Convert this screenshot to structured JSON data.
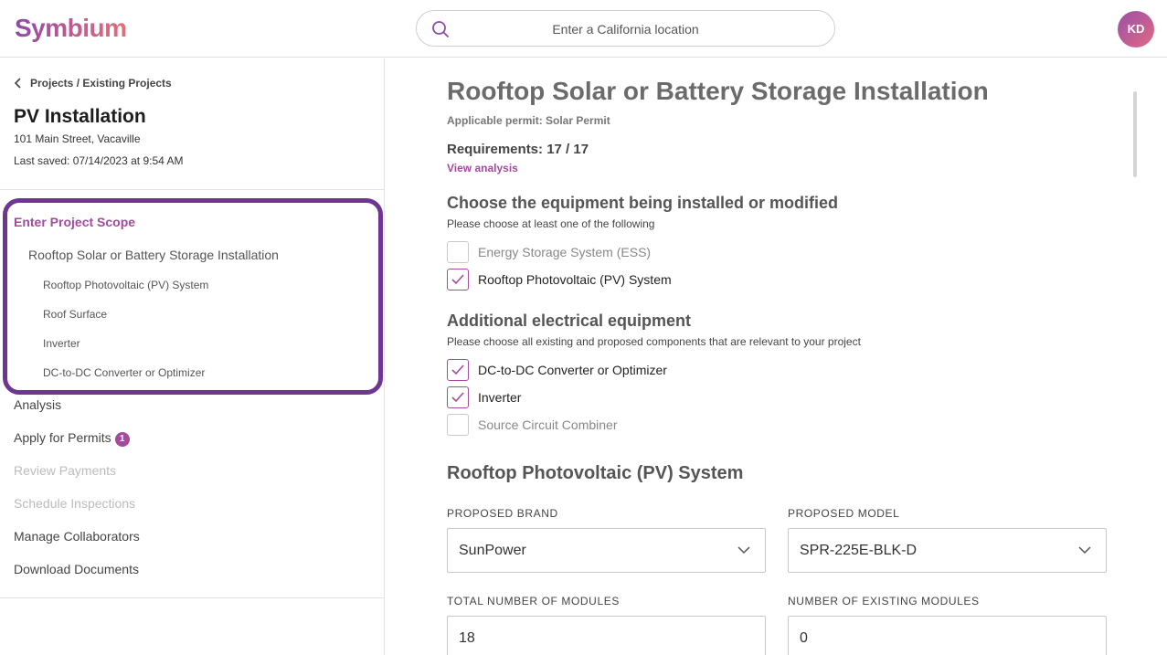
{
  "header": {
    "logo": "Symbium",
    "search_placeholder": "Enter a California location",
    "avatar_initials": "KD"
  },
  "sidebar": {
    "breadcrumb": "Projects / Existing Projects",
    "project_title": "PV Installation",
    "project_address": "101 Main Street, Vacaville",
    "last_saved": "Last saved: 07/14/2023 at 9:54 AM",
    "scope": {
      "title": "Enter Project Scope",
      "level1": "Rooftop Solar or Battery Storage Installation",
      "level2": [
        "Rooftop Photovoltaic (PV) System",
        "Roof Surface",
        "Inverter",
        "DC-to-DC Converter or Optimizer"
      ]
    },
    "nav": [
      {
        "label": "Analysis",
        "enabled": true
      },
      {
        "label": "Apply for Permits",
        "enabled": true,
        "badge": "1"
      },
      {
        "label": "Review Payments",
        "enabled": false
      },
      {
        "label": "Schedule Inspections",
        "enabled": false
      },
      {
        "label": "Manage Collaborators",
        "enabled": true
      },
      {
        "label": "Download Documents",
        "enabled": true
      }
    ]
  },
  "main": {
    "title": "Rooftop Solar or Battery Storage Installation",
    "permit": "Applicable permit: Solar Permit",
    "requirements": "Requirements: 17 / 17",
    "view_analysis": "View analysis",
    "equipment": {
      "heading": "Choose the equipment being installed or modified",
      "hint": "Please choose at least one of the following",
      "options": [
        {
          "label": "Energy Storage System (ESS)",
          "checked": false
        },
        {
          "label": "Rooftop Photovoltaic (PV) System",
          "checked": true
        }
      ]
    },
    "electrical": {
      "heading": "Additional electrical equipment",
      "hint": "Please choose all existing and proposed components that are relevant to your project",
      "options": [
        {
          "label": "DC-to-DC Converter or Optimizer",
          "checked": true
        },
        {
          "label": "Inverter",
          "checked": true
        },
        {
          "label": "Source Circuit Combiner",
          "checked": false
        }
      ]
    },
    "pv_section": {
      "heading": "Rooftop Photovoltaic (PV) System",
      "brand_label": "PROPOSED BRAND",
      "brand_value": "SunPower",
      "model_label": "PROPOSED MODEL",
      "model_value": "SPR-225E-BLK-D",
      "total_label": "TOTAL NUMBER OF MODULES",
      "total_value": "18",
      "existing_label": "NUMBER OF EXISTING MODULES",
      "existing_value": "0"
    }
  },
  "colors": {
    "accent": "#a34b9d",
    "scope_outline": "#6e3591"
  }
}
